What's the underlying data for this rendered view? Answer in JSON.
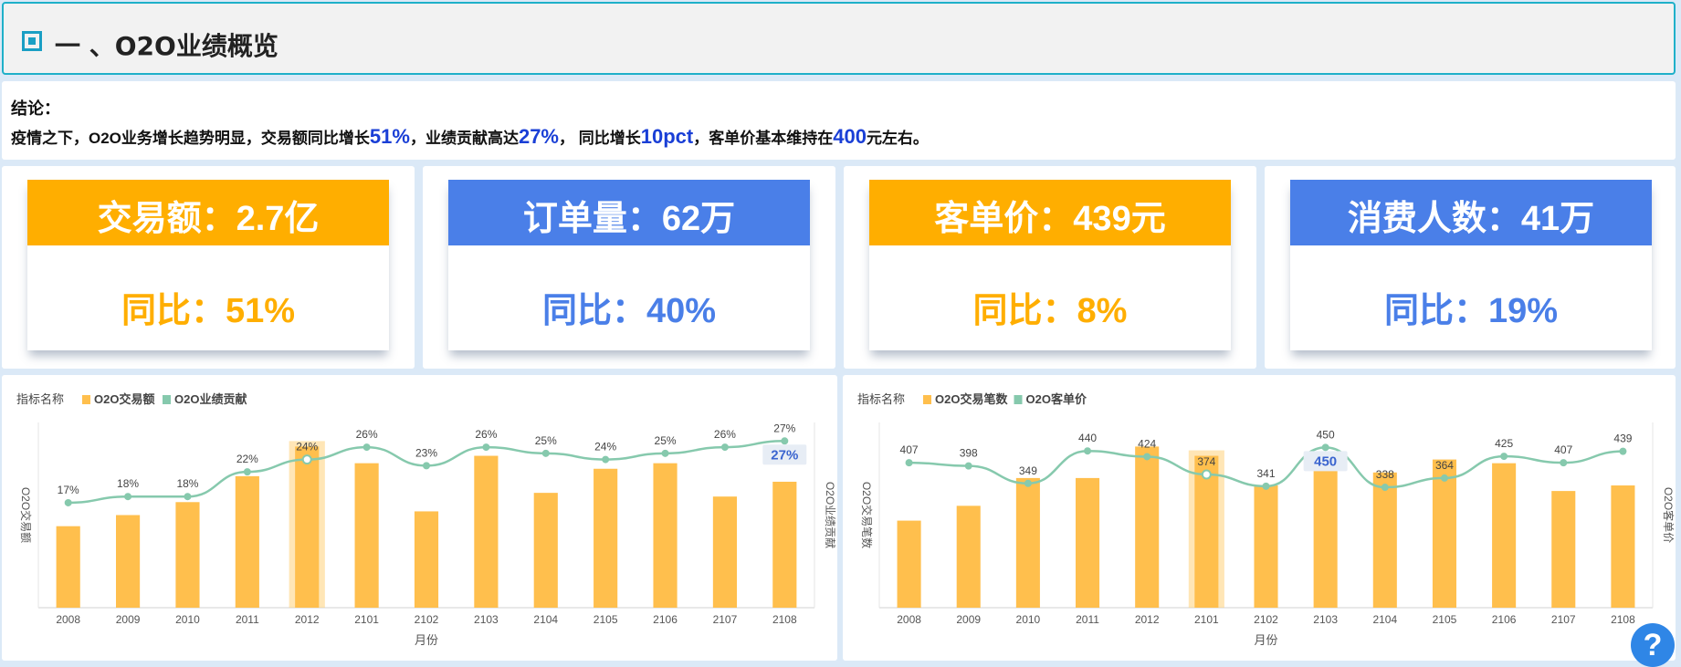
{
  "header": {
    "title": "一 、O2O业绩概览"
  },
  "conclusion": {
    "label": "结论：",
    "parts": [
      "疫情之下，O2O业务增长趋势明显，交易额同比增长",
      "51%",
      "，业绩贡献高达",
      "27%",
      "， 同比增长",
      "10pct",
      "，客单价基本维持在",
      "400",
      "元左右。"
    ]
  },
  "kpis": [
    {
      "label": "交易额：2.7亿",
      "yoy": "同比：51%",
      "color": "#ffae00"
    },
    {
      "label": "订单量：62万",
      "yoy": "同比：40%",
      "color": "#4a7fe8"
    },
    {
      "label": "客单价：439元",
      "yoy": "同比：8%",
      "color": "#ffae00"
    },
    {
      "label": "消费人数：41万",
      "yoy": "同比：19%",
      "color": "#4a7fe8"
    }
  ],
  "colors": {
    "bar": "#ffbf4d",
    "line": "#86c9ad",
    "highlight_text": "#3a64cf"
  },
  "help_label": "?",
  "chart_data": [
    {
      "type": "bar+line",
      "legend_title": "指标名称",
      "legend_position": "top-left",
      "categories": [
        "2008",
        "2009",
        "2010",
        "2011",
        "2012",
        "2101",
        "2102",
        "2103",
        "2104",
        "2105",
        "2106",
        "2107",
        "2108"
      ],
      "series": [
        {
          "name": "O2O交易额",
          "type": "bar",
          "axis": "left",
          "values": [
            44,
            50,
            57,
            71,
            87,
            78,
            52,
            82,
            62,
            75,
            78,
            60,
            68
          ]
        },
        {
          "name": "O2O业绩贡献",
          "type": "line",
          "axis": "right",
          "values": [
            17,
            18,
            18,
            22,
            24,
            26,
            23,
            26,
            25,
            24,
            25,
            26,
            27
          ],
          "labels": [
            "17%",
            "18%",
            "18%",
            "22%",
            "24%",
            "26%",
            "23%",
            "26%",
            "25%",
            "24%",
            "25%",
            "26%",
            "27%"
          ]
        }
      ],
      "xlabel": "月份",
      "ylabel_left": "O2O交易额",
      "ylabel_right": "O2O业绩贡献",
      "ylim_left": [
        0,
        100
      ],
      "ylim_right": [
        0,
        30
      ],
      "highlight_index": 4,
      "callout": "27%"
    },
    {
      "type": "bar+line",
      "legend_title": "指标名称",
      "legend_position": "top-left",
      "categories": [
        "2008",
        "2009",
        "2010",
        "2011",
        "2012",
        "2101",
        "2102",
        "2103",
        "2104",
        "2105",
        "2106",
        "2107",
        "2108"
      ],
      "series": [
        {
          "name": "O2O交易笔数",
          "type": "bar",
          "axis": "left",
          "values": [
            47,
            55,
            70,
            70,
            87,
            82,
            66,
            78,
            73,
            80,
            78,
            63,
            66
          ]
        },
        {
          "name": "O2O客单价",
          "type": "line",
          "axis": "right",
          "values": [
            407,
            398,
            349,
            440,
            424,
            374,
            341,
            450,
            338,
            364,
            425,
            407,
            439
          ],
          "labels": [
            "407",
            "398",
            "349",
            "440",
            "424",
            "374",
            "341",
            "450",
            "338",
            "364",
            "425",
            "407",
            "439"
          ]
        }
      ],
      "xlabel": "月份",
      "ylabel_left": "O2O交易笔数",
      "ylabel_right": "O2O客单价",
      "ylim_left": [
        0,
        100
      ],
      "ylim_right": [
        0,
        520
      ],
      "highlight_index": 5,
      "callout": "450"
    }
  ]
}
